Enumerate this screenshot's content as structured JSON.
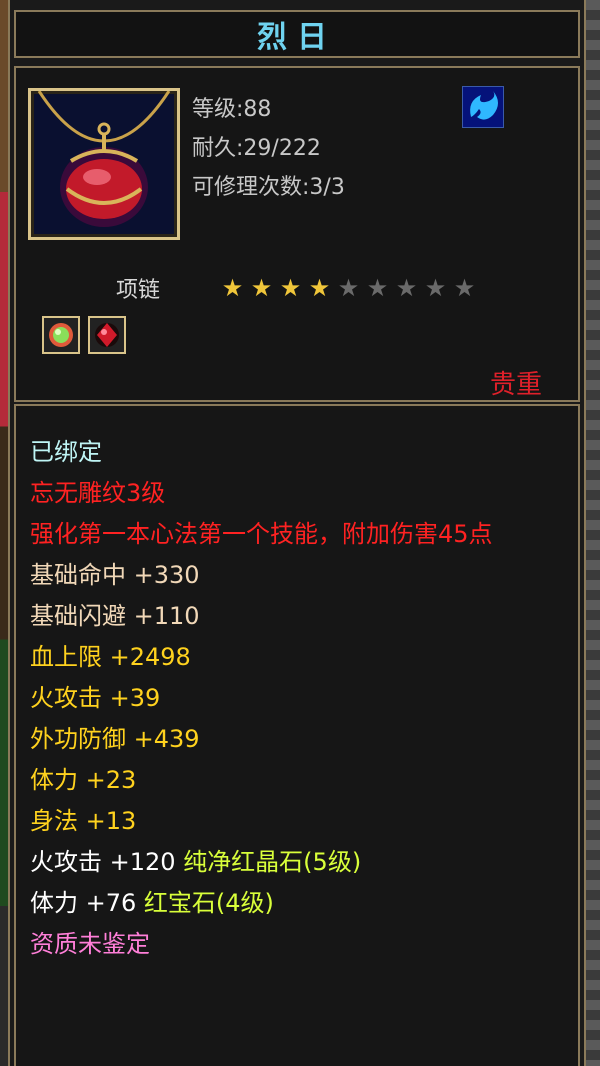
{
  "title": "烈日",
  "item": {
    "icon": "red-amulet-necklace-icon",
    "level_text": "等级:88",
    "durability_text": "耐久:29/222",
    "repair_text": "可修理次数:3/3",
    "type": "项链",
    "stars_filled": 4,
    "stars_total": 9,
    "rarity": "贵重",
    "skill_icon": "blue-flame-skill-icon",
    "gems": [
      "green-gem-slot-icon",
      "red-gem-slot-icon"
    ]
  },
  "attributes": {
    "bound": "已绑定",
    "engrave": "忘无雕纹3级",
    "engrave_effect": "强化第一本心法第一个技能，附加伤害45点",
    "hit": "基础命中 +330",
    "dodge": "基础闪避 +110",
    "hp": "血上限 +2498",
    "fire": "火攻击 +39",
    "defense": "外功防御 +439",
    "stamina": "体力 +23",
    "agility": "身法 +13",
    "gem1_stat": "火攻击 +120 ",
    "gem1_name": "纯净红晶石(5级)",
    "gem2_stat": "体力 +76 ",
    "gem2_name": "红宝石(4级)",
    "quality": "资质未鉴定"
  },
  "colors": {
    "title": "#6fd3f0",
    "rarity": "#e0202a",
    "border": "#8a7a5a",
    "gold": "#ffd21e"
  }
}
